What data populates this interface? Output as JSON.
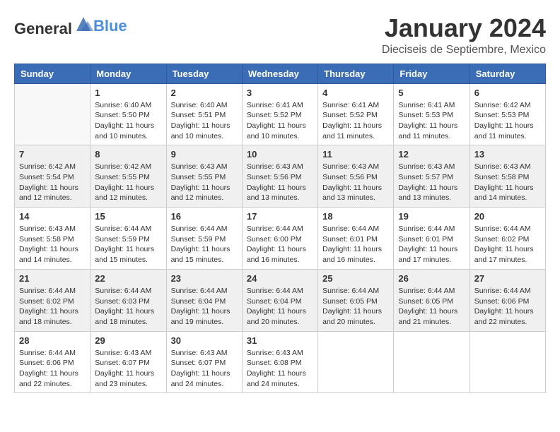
{
  "header": {
    "logo": {
      "general": "General",
      "blue": "Blue"
    },
    "title": "January 2024",
    "location": "Dieciseis de Septiembre, Mexico"
  },
  "days_of_week": [
    "Sunday",
    "Monday",
    "Tuesday",
    "Wednesday",
    "Thursday",
    "Friday",
    "Saturday"
  ],
  "weeks": [
    [
      {
        "day": "",
        "empty": true
      },
      {
        "day": "1",
        "sunrise": "Sunrise: 6:40 AM",
        "sunset": "Sunset: 5:50 PM",
        "daylight": "Daylight: 11 hours and 10 minutes."
      },
      {
        "day": "2",
        "sunrise": "Sunrise: 6:40 AM",
        "sunset": "Sunset: 5:51 PM",
        "daylight": "Daylight: 11 hours and 10 minutes."
      },
      {
        "day": "3",
        "sunrise": "Sunrise: 6:41 AM",
        "sunset": "Sunset: 5:52 PM",
        "daylight": "Daylight: 11 hours and 10 minutes."
      },
      {
        "day": "4",
        "sunrise": "Sunrise: 6:41 AM",
        "sunset": "Sunset: 5:52 PM",
        "daylight": "Daylight: 11 hours and 11 minutes."
      },
      {
        "day": "5",
        "sunrise": "Sunrise: 6:41 AM",
        "sunset": "Sunset: 5:53 PM",
        "daylight": "Daylight: 11 hours and 11 minutes."
      },
      {
        "day": "6",
        "sunrise": "Sunrise: 6:42 AM",
        "sunset": "Sunset: 5:53 PM",
        "daylight": "Daylight: 11 hours and 11 minutes."
      }
    ],
    [
      {
        "day": "7",
        "sunrise": "Sunrise: 6:42 AM",
        "sunset": "Sunset: 5:54 PM",
        "daylight": "Daylight: 11 hours and 12 minutes."
      },
      {
        "day": "8",
        "sunrise": "Sunrise: 6:42 AM",
        "sunset": "Sunset: 5:55 PM",
        "daylight": "Daylight: 11 hours and 12 minutes."
      },
      {
        "day": "9",
        "sunrise": "Sunrise: 6:43 AM",
        "sunset": "Sunset: 5:55 PM",
        "daylight": "Daylight: 11 hours and 12 minutes."
      },
      {
        "day": "10",
        "sunrise": "Sunrise: 6:43 AM",
        "sunset": "Sunset: 5:56 PM",
        "daylight": "Daylight: 11 hours and 13 minutes."
      },
      {
        "day": "11",
        "sunrise": "Sunrise: 6:43 AM",
        "sunset": "Sunset: 5:56 PM",
        "daylight": "Daylight: 11 hours and 13 minutes."
      },
      {
        "day": "12",
        "sunrise": "Sunrise: 6:43 AM",
        "sunset": "Sunset: 5:57 PM",
        "daylight": "Daylight: 11 hours and 13 minutes."
      },
      {
        "day": "13",
        "sunrise": "Sunrise: 6:43 AM",
        "sunset": "Sunset: 5:58 PM",
        "daylight": "Daylight: 11 hours and 14 minutes."
      }
    ],
    [
      {
        "day": "14",
        "sunrise": "Sunrise: 6:43 AM",
        "sunset": "Sunset: 5:58 PM",
        "daylight": "Daylight: 11 hours and 14 minutes."
      },
      {
        "day": "15",
        "sunrise": "Sunrise: 6:44 AM",
        "sunset": "Sunset: 5:59 PM",
        "daylight": "Daylight: 11 hours and 15 minutes."
      },
      {
        "day": "16",
        "sunrise": "Sunrise: 6:44 AM",
        "sunset": "Sunset: 5:59 PM",
        "daylight": "Daylight: 11 hours and 15 minutes."
      },
      {
        "day": "17",
        "sunrise": "Sunrise: 6:44 AM",
        "sunset": "Sunset: 6:00 PM",
        "daylight": "Daylight: 11 hours and 16 minutes."
      },
      {
        "day": "18",
        "sunrise": "Sunrise: 6:44 AM",
        "sunset": "Sunset: 6:01 PM",
        "daylight": "Daylight: 11 hours and 16 minutes."
      },
      {
        "day": "19",
        "sunrise": "Sunrise: 6:44 AM",
        "sunset": "Sunset: 6:01 PM",
        "daylight": "Daylight: 11 hours and 17 minutes."
      },
      {
        "day": "20",
        "sunrise": "Sunrise: 6:44 AM",
        "sunset": "Sunset: 6:02 PM",
        "daylight": "Daylight: 11 hours and 17 minutes."
      }
    ],
    [
      {
        "day": "21",
        "sunrise": "Sunrise: 6:44 AM",
        "sunset": "Sunset: 6:02 PM",
        "daylight": "Daylight: 11 hours and 18 minutes."
      },
      {
        "day": "22",
        "sunrise": "Sunrise: 6:44 AM",
        "sunset": "Sunset: 6:03 PM",
        "daylight": "Daylight: 11 hours and 18 minutes."
      },
      {
        "day": "23",
        "sunrise": "Sunrise: 6:44 AM",
        "sunset": "Sunset: 6:04 PM",
        "daylight": "Daylight: 11 hours and 19 minutes."
      },
      {
        "day": "24",
        "sunrise": "Sunrise: 6:44 AM",
        "sunset": "Sunset: 6:04 PM",
        "daylight": "Daylight: 11 hours and 20 minutes."
      },
      {
        "day": "25",
        "sunrise": "Sunrise: 6:44 AM",
        "sunset": "Sunset: 6:05 PM",
        "daylight": "Daylight: 11 hours and 20 minutes."
      },
      {
        "day": "26",
        "sunrise": "Sunrise: 6:44 AM",
        "sunset": "Sunset: 6:05 PM",
        "daylight": "Daylight: 11 hours and 21 minutes."
      },
      {
        "day": "27",
        "sunrise": "Sunrise: 6:44 AM",
        "sunset": "Sunset: 6:06 PM",
        "daylight": "Daylight: 11 hours and 22 minutes."
      }
    ],
    [
      {
        "day": "28",
        "sunrise": "Sunrise: 6:44 AM",
        "sunset": "Sunset: 6:06 PM",
        "daylight": "Daylight: 11 hours and 22 minutes."
      },
      {
        "day": "29",
        "sunrise": "Sunrise: 6:43 AM",
        "sunset": "Sunset: 6:07 PM",
        "daylight": "Daylight: 11 hours and 23 minutes."
      },
      {
        "day": "30",
        "sunrise": "Sunrise: 6:43 AM",
        "sunset": "Sunset: 6:07 PM",
        "daylight": "Daylight: 11 hours and 24 minutes."
      },
      {
        "day": "31",
        "sunrise": "Sunrise: 6:43 AM",
        "sunset": "Sunset: 6:08 PM",
        "daylight": "Daylight: 11 hours and 24 minutes."
      },
      {
        "day": "",
        "empty": true
      },
      {
        "day": "",
        "empty": true
      },
      {
        "day": "",
        "empty": true
      }
    ]
  ]
}
